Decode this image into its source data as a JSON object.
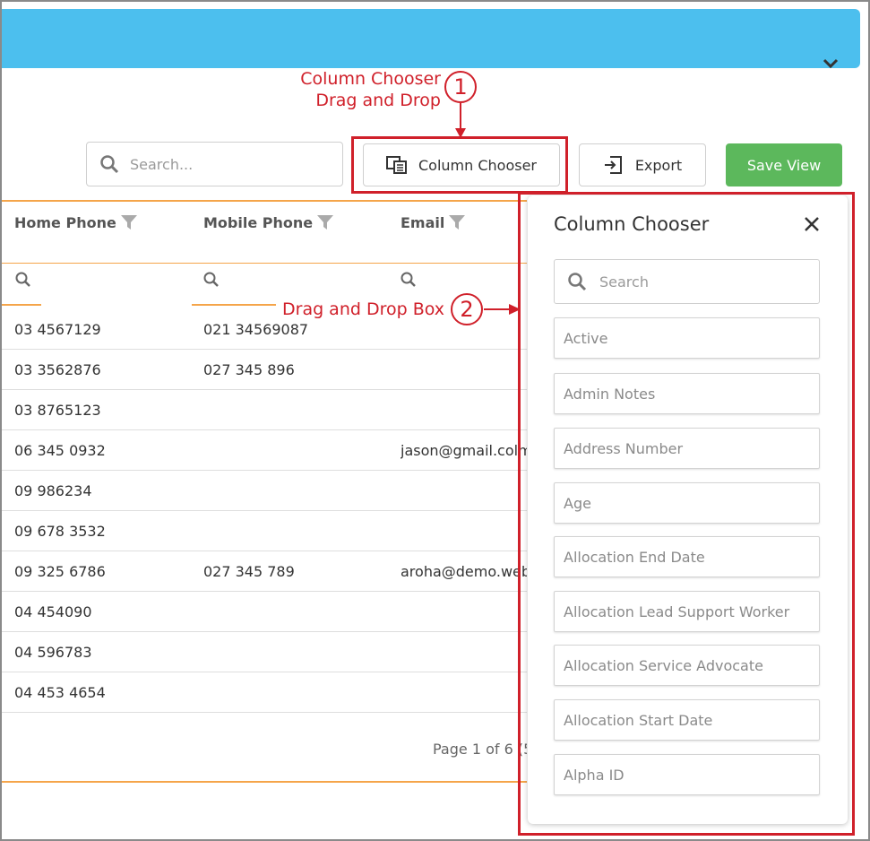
{
  "annotations": {
    "marker_1": "1",
    "label_1_line1": "Column Chooser",
    "label_1_line2": "Drag and Drop",
    "marker_2": "2",
    "label_2": "Drag and Drop Box"
  },
  "toolbar": {
    "search_placeholder": "Search...",
    "column_chooser_label": "Column Chooser",
    "export_label": "Export",
    "save_view_label": "Save View"
  },
  "grid": {
    "columns": [
      "Home Phone",
      "Mobile Phone",
      "Email"
    ],
    "rows": [
      {
        "home": "03 4567129",
        "mobile": "021 34569087",
        "email": ""
      },
      {
        "home": "03 3562876",
        "mobile": "027 345 896",
        "email": ""
      },
      {
        "home": "03 8765123",
        "mobile": "",
        "email": ""
      },
      {
        "home": "06 345 0932",
        "mobile": "",
        "email": "jason@gmail.colm"
      },
      {
        "home": "09 986234",
        "mobile": "",
        "email": ""
      },
      {
        "home": "09 678 3532",
        "mobile": "",
        "email": ""
      },
      {
        "home": "09 325 6786",
        "mobile": "027 345 789",
        "email": "aroha@demo.web"
      },
      {
        "home": "04 454090",
        "mobile": "",
        "email": ""
      },
      {
        "home": "04 596783",
        "mobile": "",
        "email": ""
      },
      {
        "home": "04 453 4654",
        "mobile": "",
        "email": ""
      }
    ],
    "pager_text": "Page 1 of 6 (5"
  },
  "column_chooser": {
    "title": "Column Chooser",
    "search_placeholder": "Search",
    "items": [
      "Active",
      "Admin Notes",
      "Address Number",
      "Age",
      "Allocation End Date",
      "Allocation Lead Support Worker",
      "Allocation Service Advocate",
      "Allocation Start Date",
      "Alpha ID"
    ]
  },
  "colors": {
    "header_bar": "#4cbfee",
    "accent_orange": "#f5a54a",
    "save_green": "#5cb85c",
    "annotation_red": "#d0202a"
  }
}
